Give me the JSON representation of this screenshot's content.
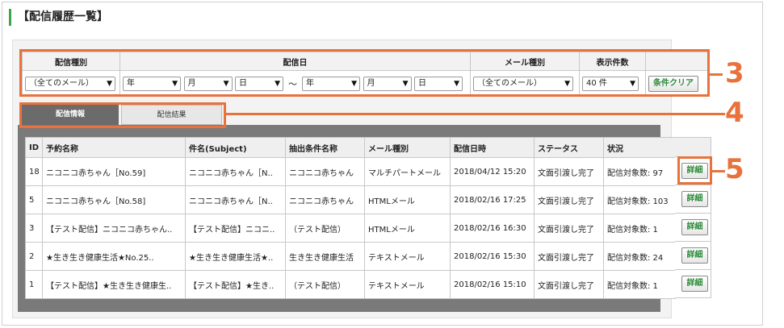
{
  "page": {
    "title": "【配信履歴一覧】"
  },
  "filter": {
    "headers": {
      "delivery_type": "配信種別",
      "delivery_date": "配信日",
      "mail_type": "メール種別",
      "display_count": "表示件数"
    },
    "delivery_type_value": "（全てのメール）",
    "from_year": "年",
    "from_month": "月",
    "from_day": "日",
    "tilde": "～",
    "to_year": "年",
    "to_month": "月",
    "to_day": "日",
    "mail_type_value": "（全てのメール）",
    "display_count_value": "40 件",
    "clear_label": "条件クリア",
    "dropdown_arrow": "▼"
  },
  "tabs": [
    {
      "label": "配信情報",
      "active": true
    },
    {
      "label": "配信結果",
      "active": false
    }
  ],
  "table": {
    "columns": [
      "ID",
      "予約名称",
      "件名(Subject)",
      "抽出条件名称",
      "メール種別",
      "配信日時",
      "ステータス",
      "状況"
    ],
    "detail_label": "詳細",
    "rows": [
      [
        "18",
        "ニコニコ赤ちゃん［No.59]",
        "ニコニコ赤ちゃん［N..",
        "ニコニコ赤ちゃん",
        "マルチパートメール",
        "2018/04/12 15:20",
        "文面引渡し完了",
        "配信対象数: 97"
      ],
      [
        "5",
        "ニコニコ赤ちゃん［No.58]",
        "ニコニコ赤ちゃん［N..",
        "ニコニコ赤ちゃん",
        "HTMLメール",
        "2018/02/16 17:25",
        "文面引渡し完了",
        "配信対象数: 103"
      ],
      [
        "3",
        "【テスト配信】ニコニコ赤ちゃん..",
        "【テスト配信】ニコニ..",
        "（テスト配信）",
        "HTMLメール",
        "2018/02/16 16:30",
        "文面引渡し完了",
        "配信対象数: 1"
      ],
      [
        "2",
        "★生き生き健康生活★No.25..",
        "★生き生き健康生活★..",
        "生き生き健康生活",
        "テキストメール",
        "2018/02/16 15:30",
        "文面引渡し完了",
        "配信対象数: 24"
      ],
      [
        "1",
        "【テスト配信】★生き生き健康生..",
        "【テスト配信】★生き..",
        "（テスト配信）",
        "テキストメール",
        "2018/02/16 15:10",
        "文面引渡し完了",
        "配信対象数: 1"
      ]
    ]
  },
  "annotations": {
    "n3": "3",
    "n4": "4",
    "n5": "5"
  },
  "colors": {
    "accent_orange": "#e8713c",
    "accent_green": "#3aa84a",
    "tab_active": "#6b6b6b"
  }
}
